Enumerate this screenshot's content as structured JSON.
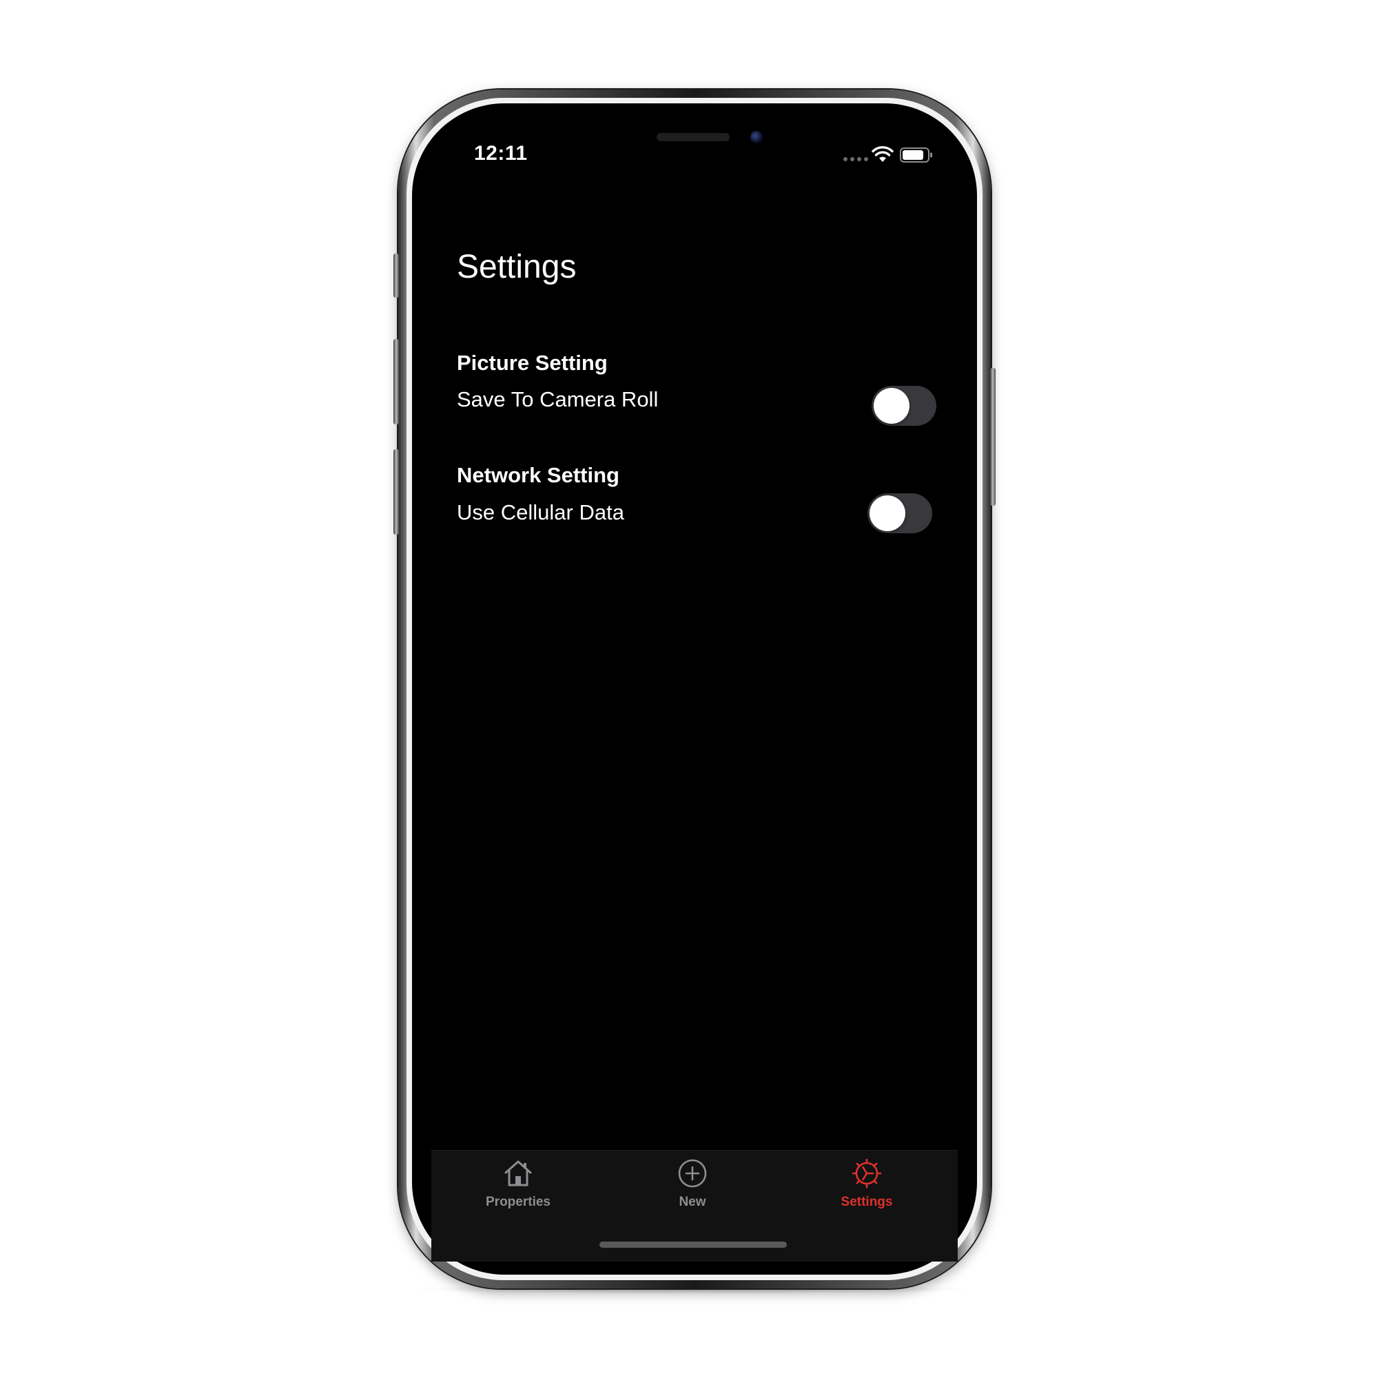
{
  "status_bar": {
    "time": "12:11"
  },
  "page": {
    "title": "Settings"
  },
  "sections": [
    {
      "header": "Picture Setting",
      "row_label": "Save To Camera Roll",
      "toggle_on": false
    },
    {
      "header": "Network Setting",
      "row_label": "Use Cellular Data",
      "toggle_on": false
    }
  ],
  "tab_bar": {
    "tabs": [
      {
        "label": "Properties",
        "icon": "house-icon",
        "active": false
      },
      {
        "label": "New",
        "icon": "plus-circle-icon",
        "active": false
      },
      {
        "label": "Settings",
        "icon": "gear-icon",
        "active": true
      }
    ]
  },
  "colors": {
    "accent": "#e0312b",
    "inactive_tab": "#8e8e93",
    "toggle_off_track": "#39393d",
    "background": "#000000"
  }
}
